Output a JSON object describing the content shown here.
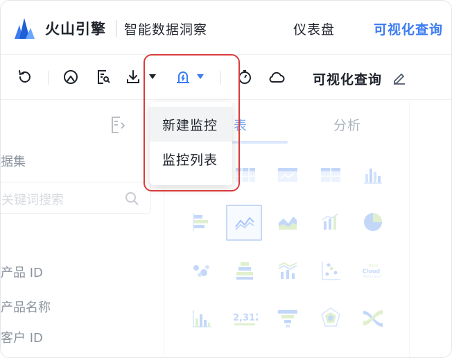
{
  "header": {
    "brand": "火山引擎",
    "product": "智能数据洞察",
    "nav": {
      "dashboard": "仪表盘",
      "visual_query": "可视化查询"
    },
    "active_color": "#3b7cf0"
  },
  "toolbar": {
    "icons": [
      "refresh-icon",
      "location-icon",
      "report-search-icon",
      "download-icon",
      "monitor-alert-icon",
      "clock-timer-icon",
      "cloud-icon"
    ],
    "title": "可视化查询",
    "edit_icon": "edit-pencil-icon"
  },
  "left_panel": {
    "section_label": "据集",
    "search_placeholder": "关键词搜索",
    "fields": [
      "产品 ID",
      "产品名称",
      "客户 ID"
    ]
  },
  "right_panel": {
    "tab_partial": "表",
    "tab_analysis": "分析"
  },
  "dropdown": {
    "items": [
      "新建监控",
      "监控列表"
    ]
  },
  "highlight_color": "#d93a3a"
}
